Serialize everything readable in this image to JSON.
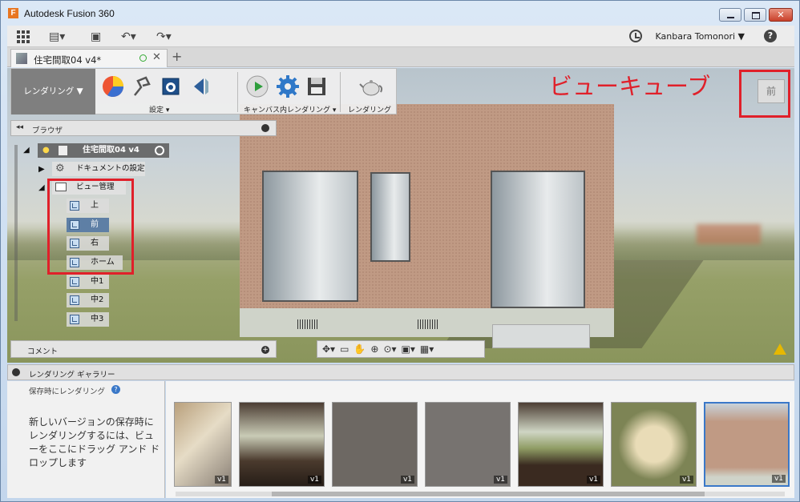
{
  "window": {
    "title": "Autodesk Fusion 360",
    "logo": "F",
    "close_glyph": "✕"
  },
  "toolbar": {
    "user": "Kanbara Tomonori ▼",
    "help": "?",
    "file_glyph": "▤▾",
    "save_glyph": "▣",
    "undo_glyph": "↶▾",
    "redo_glyph": "↷▾"
  },
  "tabs": [
    {
      "label": "住宅間取04 v4*"
    }
  ],
  "add_tab": "+",
  "ribbon": {
    "workspace": "レンダリング ▼",
    "groups": [
      {
        "label": "設定 ▾"
      },
      {
        "label": "キャンバス内レンダリング ▾"
      },
      {
        "label": "レンダリング"
      }
    ]
  },
  "browser": {
    "title": "ブラウザ",
    "collapse": "◂◂",
    "root": "住宅間取04 v4",
    "doc_settings": "ドキュメントの設定",
    "view_manager": "ビュー管理",
    "views": [
      "上",
      "前",
      "右",
      "ホーム",
      "中1",
      "中2",
      "中3"
    ],
    "selected_view": "前"
  },
  "comment_bar": {
    "label": "コメント",
    "plus": "+"
  },
  "navbar": {
    "icons": [
      "✥▾",
      "▭",
      "✋",
      "⊕",
      "⊙▾",
      "▣▾",
      "▦▾"
    ]
  },
  "viewcube": {
    "face": "前"
  },
  "annotation": "ビューキューブ",
  "gallery": {
    "title": "レンダリング ギャラリー",
    "save_render_label": "保存時にレンダリング",
    "help": "?",
    "instructions": "新しいバージョンの保存時にレンダリングするには、ビューをここにドラッグ アンド ドロップします",
    "thumbs": [
      "v1",
      "v1",
      "v1",
      "v1",
      "v1",
      "v1",
      "v1"
    ]
  },
  "colors": {
    "annotation_red": "#e0202a",
    "workspace_btn": "#7f7f7f",
    "selected": "#5e7fa5"
  }
}
